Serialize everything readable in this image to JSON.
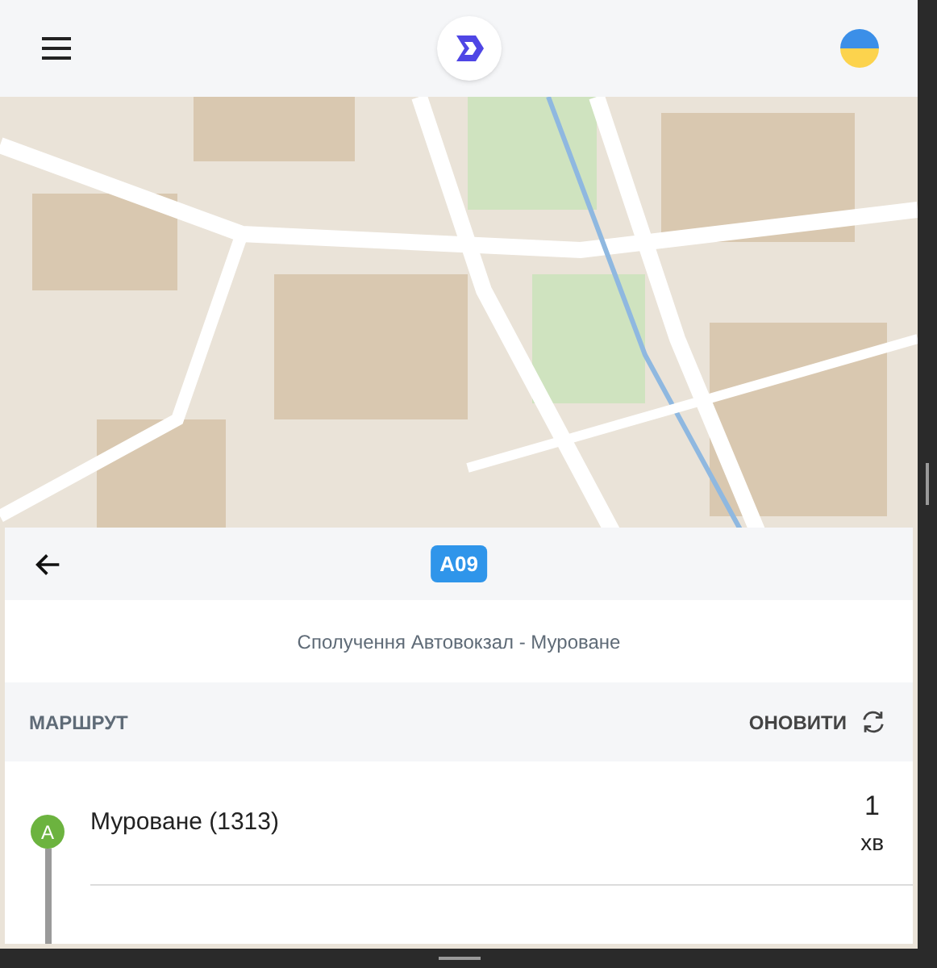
{
  "route": {
    "badge": "A09",
    "subtitle": "Сполучення Автовокзал - Муроване"
  },
  "section": {
    "title": "МАРШРУТ",
    "refresh": "ОНОВИТИ"
  },
  "stops": [
    {
      "marker": "A",
      "name": "Муроване (1313)",
      "time": "1",
      "unit": "хв",
      "color": "#6cb33f"
    }
  ]
}
